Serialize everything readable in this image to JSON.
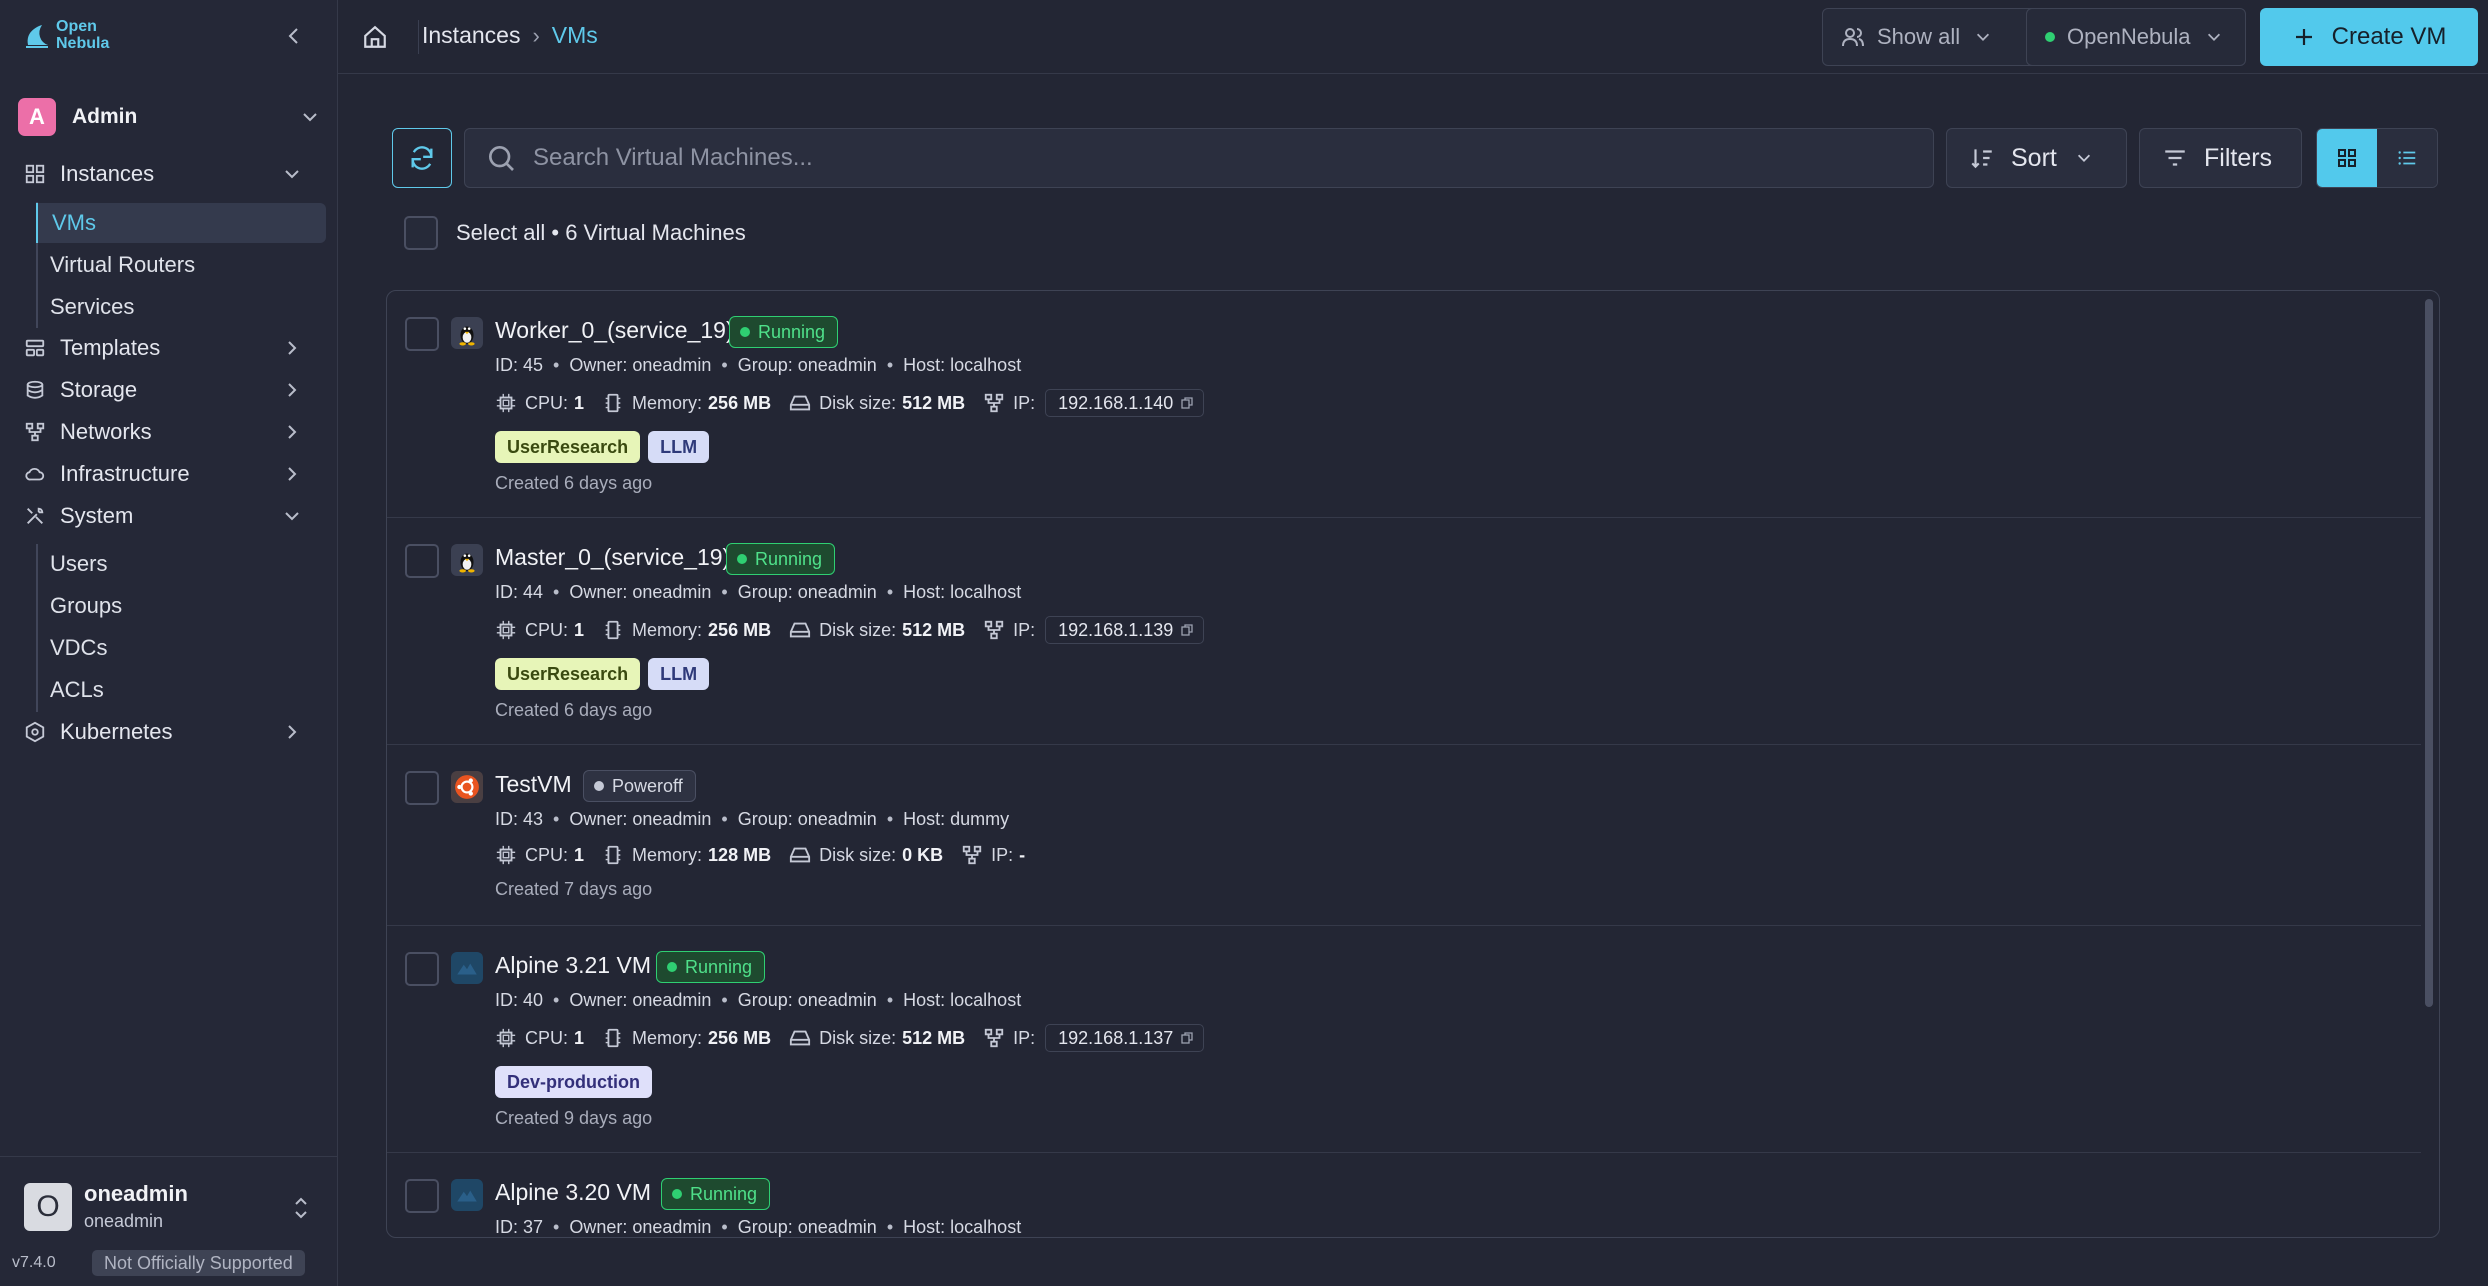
{
  "sidebar": {
    "logo": {
      "line1": "Open",
      "line2": "Nebula"
    },
    "account": {
      "avatar_letter": "A",
      "name": "Admin"
    },
    "nav": {
      "instances": "Instances",
      "vms": "VMs",
      "virtual_routers": "Virtual Routers",
      "services": "Services",
      "templates": "Templates",
      "storage": "Storage",
      "networks": "Networks",
      "infrastructure": "Infrastructure",
      "system": "System",
      "users": "Users",
      "groups": "Groups",
      "vdcs": "VDCs",
      "acls": "ACLs",
      "kubernetes": "Kubernetes"
    },
    "user": {
      "avatar_letter": "O",
      "name": "oneadmin",
      "group": "oneadmin"
    },
    "version": "v7.4.0",
    "support_badge": "Not Officially Supported"
  },
  "topbar": {
    "breadcrumb": {
      "parent": "Instances",
      "current": "VMs"
    },
    "show_all": "Show all",
    "zone": "OpenNebula",
    "create": "Create VM"
  },
  "toolbar": {
    "search_placeholder": "Search Virtual Machines...",
    "sort": "Sort",
    "filters": "Filters",
    "select_all": "Select all • 6 Virtual Machines"
  },
  "field_labels": {
    "cpu": "CPU:",
    "memory": "Memory:",
    "disk": "Disk size:",
    "ip": "IP:"
  },
  "vms": [
    {
      "name": "Worker_0_(service_19)",
      "os_icon": "linux-tux-icon",
      "state": "Running",
      "id": "ID: 45",
      "owner": "Owner: oneadmin",
      "group": "Group: oneadmin",
      "host": "Host: localhost",
      "cpu": "1",
      "memory": "256 MB",
      "disk": "512 MB",
      "ip": "192.168.1.140",
      "labels": [
        "UserResearch",
        "LLM"
      ],
      "created": "Created 6 days ago"
    },
    {
      "name": "Master_0_(service_19)",
      "os_icon": "linux-tux-icon",
      "state": "Running",
      "id": "ID: 44",
      "owner": "Owner: oneadmin",
      "group": "Group: oneadmin",
      "host": "Host: localhost",
      "cpu": "1",
      "memory": "256 MB",
      "disk": "512 MB",
      "ip": "192.168.1.139",
      "labels": [
        "UserResearch",
        "LLM"
      ],
      "created": "Created 6 days ago"
    },
    {
      "name": "TestVM",
      "os_icon": "ubuntu-icon",
      "state": "Poweroff",
      "id": "ID: 43",
      "owner": "Owner: oneadmin",
      "group": "Group: oneadmin",
      "host": "Host: dummy",
      "cpu": "1",
      "memory": "128 MB",
      "disk": "0 KB",
      "ip": "-",
      "labels": [],
      "created": "Created 7 days ago"
    },
    {
      "name": "Alpine 3.21 VM",
      "os_icon": "alpine-icon",
      "state": "Running",
      "id": "ID: 40",
      "owner": "Owner: oneadmin",
      "group": "Group: oneadmin",
      "host": "Host: localhost",
      "cpu": "1",
      "memory": "256 MB",
      "disk": "512 MB",
      "ip": "192.168.1.137",
      "labels": [
        "Dev-production"
      ],
      "created": "Created 9 days ago"
    },
    {
      "name": "Alpine 3.20 VM",
      "os_icon": "alpine-icon",
      "state": "Running",
      "id": "ID: 37",
      "owner": "Owner: oneadmin",
      "group": "Group: oneadmin",
      "host": "Host: localhost",
      "labels": [],
      "created": ""
    }
  ],
  "label_colors": {
    "UserResearch": {
      "bg": "#e7f5b8",
      "fg": "#3a4a10"
    },
    "LLM": {
      "bg": "#d6dcf7",
      "fg": "#2f3a7a"
    },
    "Dev-production": {
      "bg": "#dfe0fa",
      "fg": "#33307a"
    }
  },
  "colors": {
    "accent": "#52c9ec",
    "running": "#2fcf72",
    "background": "#232634"
  }
}
